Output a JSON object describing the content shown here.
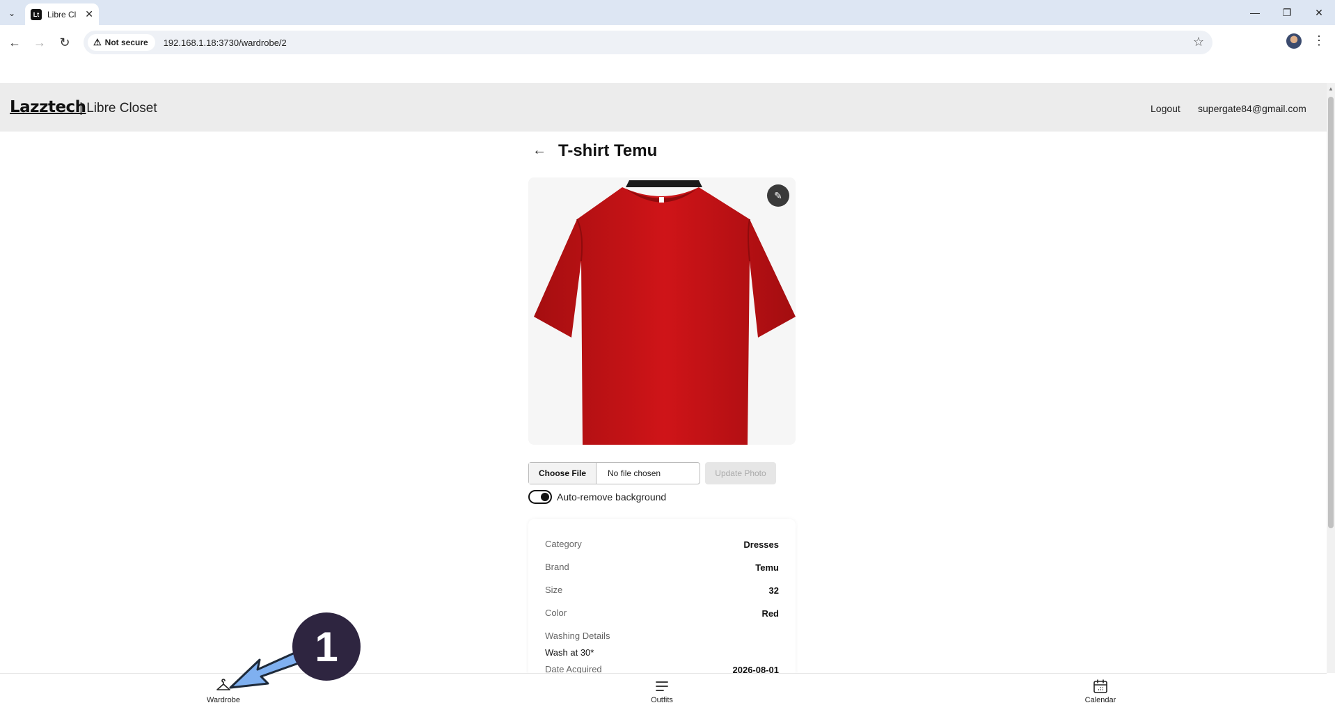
{
  "browser": {
    "tab_title": "Libre Cl",
    "security_label": "Not secure",
    "url": "192.168.1.18:3730/wardrobe/2"
  },
  "header": {
    "logo_text": "Lazztech",
    "app_name": "| Libre Closet",
    "logout_label": "Logout",
    "user_email": "supergate84@gmail.com"
  },
  "item": {
    "title": "T-shirt Temu",
    "shirt_color": "#c41215"
  },
  "upload": {
    "choose_file_label": "Choose File",
    "file_status": "No file chosen",
    "update_photo_label": "Update Photo",
    "auto_remove_label": "Auto-remove background",
    "auto_remove_enabled": true
  },
  "details": {
    "category_label": "Category",
    "category_value": "Dresses",
    "brand_label": "Brand",
    "brand_value": "Temu",
    "size_label": "Size",
    "size_value": "32",
    "color_label": "Color",
    "color_value": "Red",
    "washing_label": "Washing Details",
    "washing_value": "Wash at 30*",
    "acquired_label": "Date Acquired",
    "acquired_value": "2026-08-01"
  },
  "bottom_nav": {
    "wardrobe_label": "Wardrobe",
    "outfits_label": "Outfits",
    "calendar_label": "Calendar"
  },
  "annotation": {
    "step_number": "1",
    "arrow_color": "#7fb0f0"
  }
}
